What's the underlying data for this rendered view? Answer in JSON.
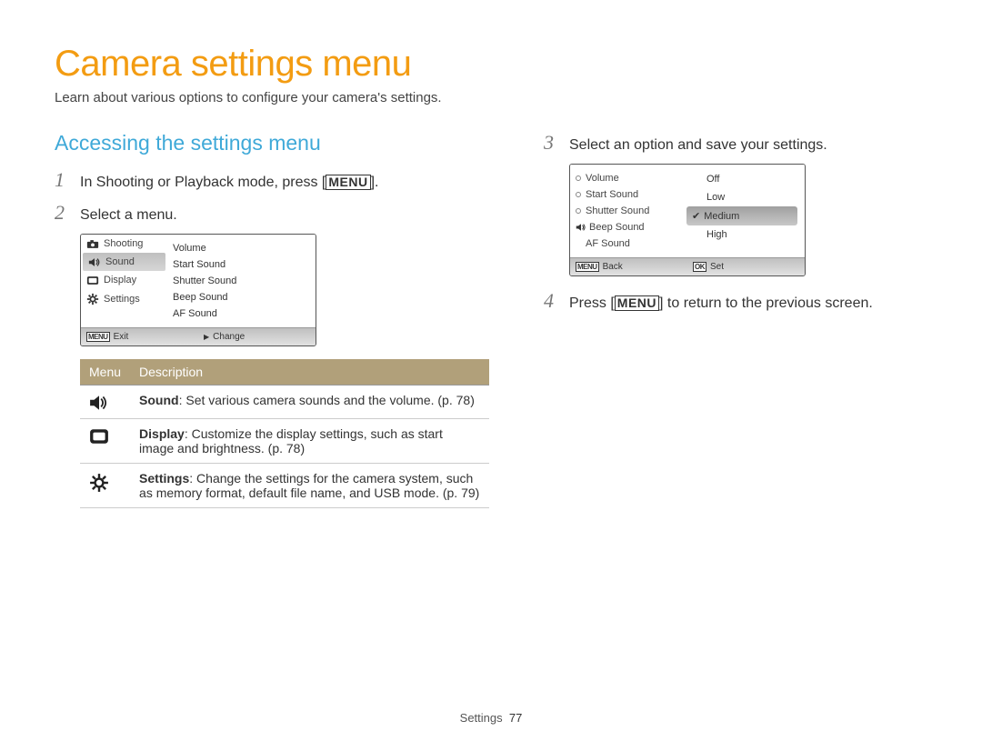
{
  "title": "Camera settings menu",
  "subtitle": "Learn about various options to configure your camera's settings.",
  "section_title": "Accessing the settings menu",
  "steps": {
    "s1_pre": "In Shooting or Playback mode, press [",
    "s1_btn": "MENU",
    "s1_post": "].",
    "s2": "Select a menu.",
    "s3": "Select an option and save your settings.",
    "s4_pre": "Press [",
    "s4_btn": "MENU",
    "s4_post": "] to return to the previous screen."
  },
  "screen1": {
    "left": [
      "Shooting",
      "Sound",
      "Display",
      "Settings"
    ],
    "right": [
      "Volume",
      "Start Sound",
      "Shutter Sound",
      "Beep Sound",
      "AF Sound"
    ],
    "footer_left_btn": "MENU",
    "footer_left": "Exit",
    "footer_right_icon": "▶",
    "footer_right": "Change"
  },
  "screen2": {
    "left": [
      "Volume",
      "Start Sound",
      "Shutter Sound",
      "Beep Sound",
      "AF Sound"
    ],
    "options": [
      "Off",
      "Low",
      "Medium",
      "High"
    ],
    "selected": "Medium",
    "footer_left_btn": "MENU",
    "footer_left": "Back",
    "footer_right_btn": "OK",
    "footer_right": "Set"
  },
  "table": {
    "head_menu": "Menu",
    "head_desc": "Description",
    "rows": [
      {
        "bold": "Sound",
        "text": ": Set various camera sounds and the volume. (p. 78)"
      },
      {
        "bold": "Display",
        "text": ": Customize the display settings, such as start image and brightness. (p. 78)"
      },
      {
        "bold": "Settings",
        "text": ": Change the settings for the camera system, such as memory format, default file name, and USB mode. (p. 79)"
      }
    ]
  },
  "footer": {
    "label": "Settings",
    "page": "77"
  }
}
